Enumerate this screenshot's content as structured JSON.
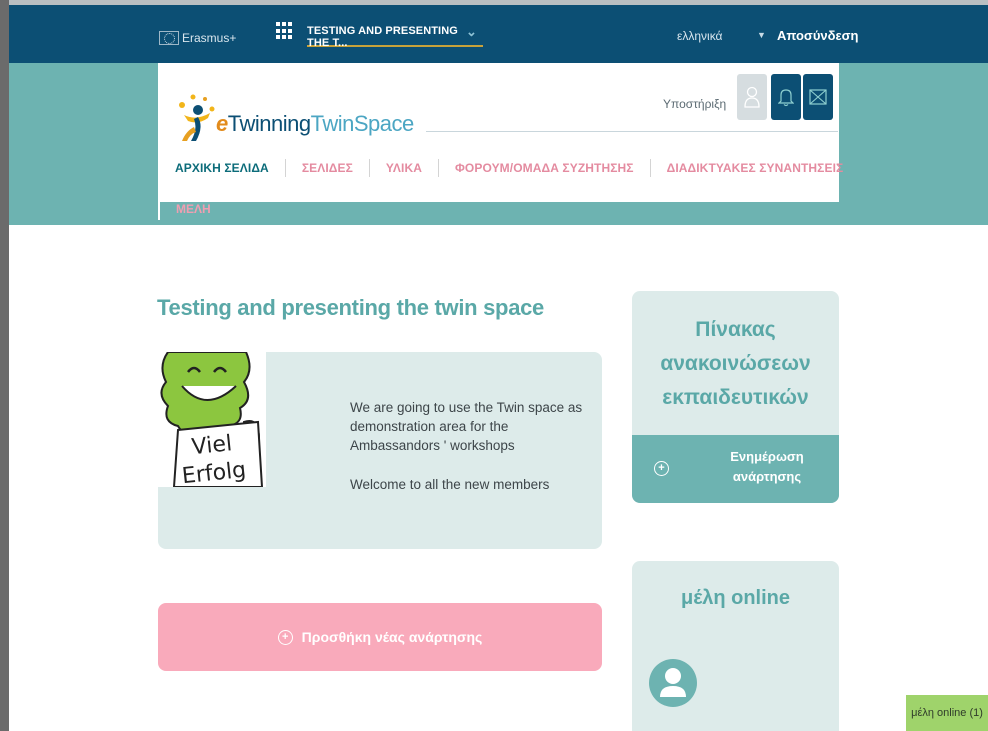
{
  "topbar": {
    "erasmus_label": "Erasmus+",
    "space_selector": "TESTING AND PRESENTING THE T...",
    "language": "ελληνικά",
    "logout": "Αποσύνδεση"
  },
  "header": {
    "logo_e": "e",
    "logo_twinning": "Twinning",
    "logo_twinspace": "TwinSpace",
    "support": "Υποστήριξη"
  },
  "nav": {
    "items": [
      {
        "label": "ΑΡΧΙΚΗ ΣΕΛΙΔΑ"
      },
      {
        "label": "ΣΕΛΙΔΕΣ"
      },
      {
        "label": "ΥΛΙΚΑ"
      },
      {
        "label": "ΦΟΡΟΥΜ/ΟΜΑΔΑ ΣΥΖΗΤΗΣΗΣ"
      },
      {
        "label": "ΔΙΑΔΙΚΤΥΑΚΕΣ ΣΥΝΑΝΤΗΣΕΙΣ"
      }
    ],
    "members": "ΜΕΛΗ"
  },
  "main": {
    "title": "Testing and presenting the twin space",
    "intro_image_text_line1": "Viel",
    "intro_image_text_line2": "Erfolg",
    "intro_paragraph1": "We are going to use the Twin space as demonstration area for the Ambassandors ' workshops",
    "intro_paragraph2": "Welcome to all the new members",
    "add_post_label": "Προσθήκη νέας ανάρτησης"
  },
  "sidebar": {
    "board_title": "Πίνακας ανακοινώσεων εκπαιδευτικών",
    "board_update": "Ενημέρωση ανάρτησης",
    "online_title": "μέλη online",
    "online_chip": "μέλη online (1)"
  },
  "colors": {
    "navy": "#0c4f74",
    "teal": "#6db3b1",
    "teal_text": "#5aa8a7",
    "pale_teal": "#ddebea",
    "pink": "#f9aabb",
    "nav_pink": "#e48ba0",
    "chip_green": "#9fd36b"
  },
  "icons": [
    "apps-grid-icon",
    "chevron-down-icon",
    "user-icon",
    "bell-icon",
    "mail-icon",
    "plus-circle-icon",
    "avatar-icon"
  ]
}
